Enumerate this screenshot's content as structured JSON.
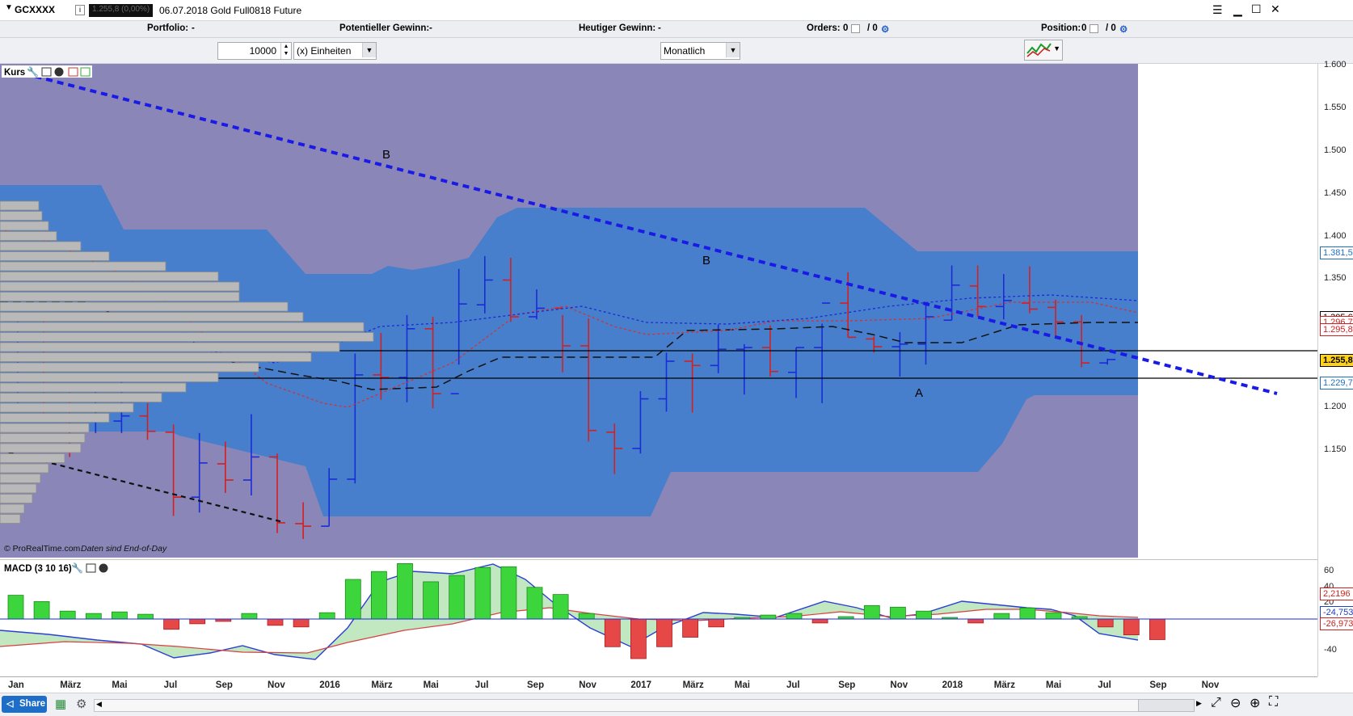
{
  "window": {
    "symbol": "GCXXXX",
    "price_tag": "1.255,8 (0,00%)",
    "description": "06.07.2018 Gold Full0818 Future"
  },
  "account": {
    "portfolio_label": "Portfolio:",
    "portfolio_value": "-",
    "potential_gain_label": "Potentieller Gewinn:",
    "potential_gain_value": "-",
    "today_gain_label": "Heutiger Gewinn:",
    "today_gain_value": "-",
    "orders_label": "Orders:",
    "orders_value": "0",
    "orders_value2": "/ 0",
    "position_label": "Position:",
    "position_value": "0",
    "position_value2": "/ 0"
  },
  "toolbar": {
    "quantity": "10000",
    "unit": "(x) Einheiten",
    "timeframe": "Monatlich"
  },
  "price_panel": {
    "title": "Kurs",
    "watermark": "© ProRealTime.com",
    "watermark_note": "Daten sind End-of-Day",
    "annotations": [
      "B",
      "B",
      "A"
    ]
  },
  "macd_panel": {
    "title": "MACD (3 10 16)"
  },
  "y_axis_price": [
    "1.600",
    "1.550",
    "1.500",
    "1.450",
    "1.400",
    "1.350",
    "1.300",
    "1.250",
    "1.200",
    "1.150"
  ],
  "price_tags": [
    {
      "text": "1.381,5",
      "color": "#1f6fc0",
      "bg": "#ffffff"
    },
    {
      "text": "1.305,6",
      "color": "#000000",
      "bg": "#ffffff"
    },
    {
      "text": "1.296,7",
      "color": "#d02020",
      "bg": "#ffffff"
    },
    {
      "text": "1.295,8",
      "color": "#d02020",
      "bg": "#ffffff"
    },
    {
      "text": "1.255,8",
      "color": "#000000",
      "bg": "#ffd21a"
    },
    {
      "text": "1.229,7",
      "color": "#1f6fc0",
      "bg": "#ffffff"
    }
  ],
  "y_axis_macd": [
    "60",
    "40",
    "20",
    "-40"
  ],
  "macd_tags": [
    {
      "text": "2,2196",
      "color": "#d02020"
    },
    {
      "text": "-24,753",
      "color": "#1f3fc0"
    },
    {
      "text": "-26,973",
      "color": "#d02020"
    }
  ],
  "x_axis": [
    "Jan",
    "März",
    "Mai",
    "Jul",
    "Sep",
    "Nov",
    "2016",
    "März",
    "Mai",
    "Jul",
    "Sep",
    "Nov",
    "2017",
    "März",
    "Mai",
    "Jul",
    "Sep",
    "Nov",
    "2018",
    "März",
    "Mai",
    "Jul",
    "Sep",
    "Nov"
  ],
  "bottom": {
    "share_label": "Share"
  },
  "colors": {
    "background": "#8a86b8",
    "cloud": "#3d7fcf",
    "trendline": "#1a1ae6",
    "up_bar": "#1a2bd8",
    "down_bar": "#d42020"
  }
}
